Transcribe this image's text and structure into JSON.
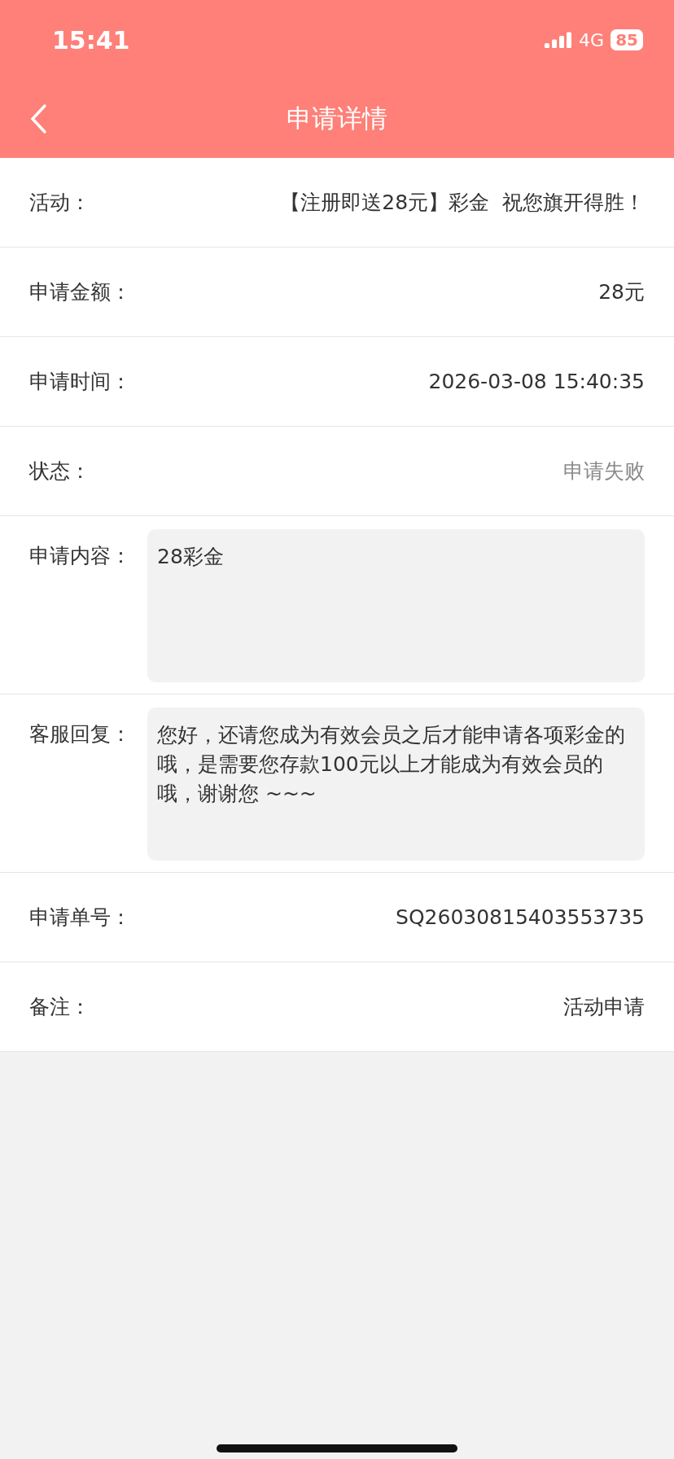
{
  "status_bar": {
    "time": "15:41",
    "network": "4G",
    "battery": "85"
  },
  "nav": {
    "title": "申请详情"
  },
  "rows": [
    {
      "kind": "text",
      "label": "活动：",
      "value": "【注册即送28元】彩金  祝您旗开得胜！",
      "muted": false
    },
    {
      "kind": "text",
      "label": "申请金额：",
      "value": "28元",
      "muted": false
    },
    {
      "kind": "text",
      "label": "申请时间：",
      "value": "2026-03-08 15:40:35",
      "muted": false
    },
    {
      "kind": "text",
      "label": "状态：",
      "value": "申请失败",
      "muted": true
    },
    {
      "kind": "box",
      "label": "申请内容：",
      "value": "28彩金"
    },
    {
      "kind": "box",
      "label": "客服回复：",
      "value": "您好，还请您成为有效会员之后才能申请各项彩金的哦，是需要您存款100元以上才能成为有效会员的哦，谢谢您 ~~~"
    },
    {
      "kind": "text",
      "label": "申请单号：",
      "value": "SQ26030815403553735",
      "muted": false
    },
    {
      "kind": "text",
      "label": "备注：",
      "value": "活动申请",
      "muted": false
    }
  ]
}
